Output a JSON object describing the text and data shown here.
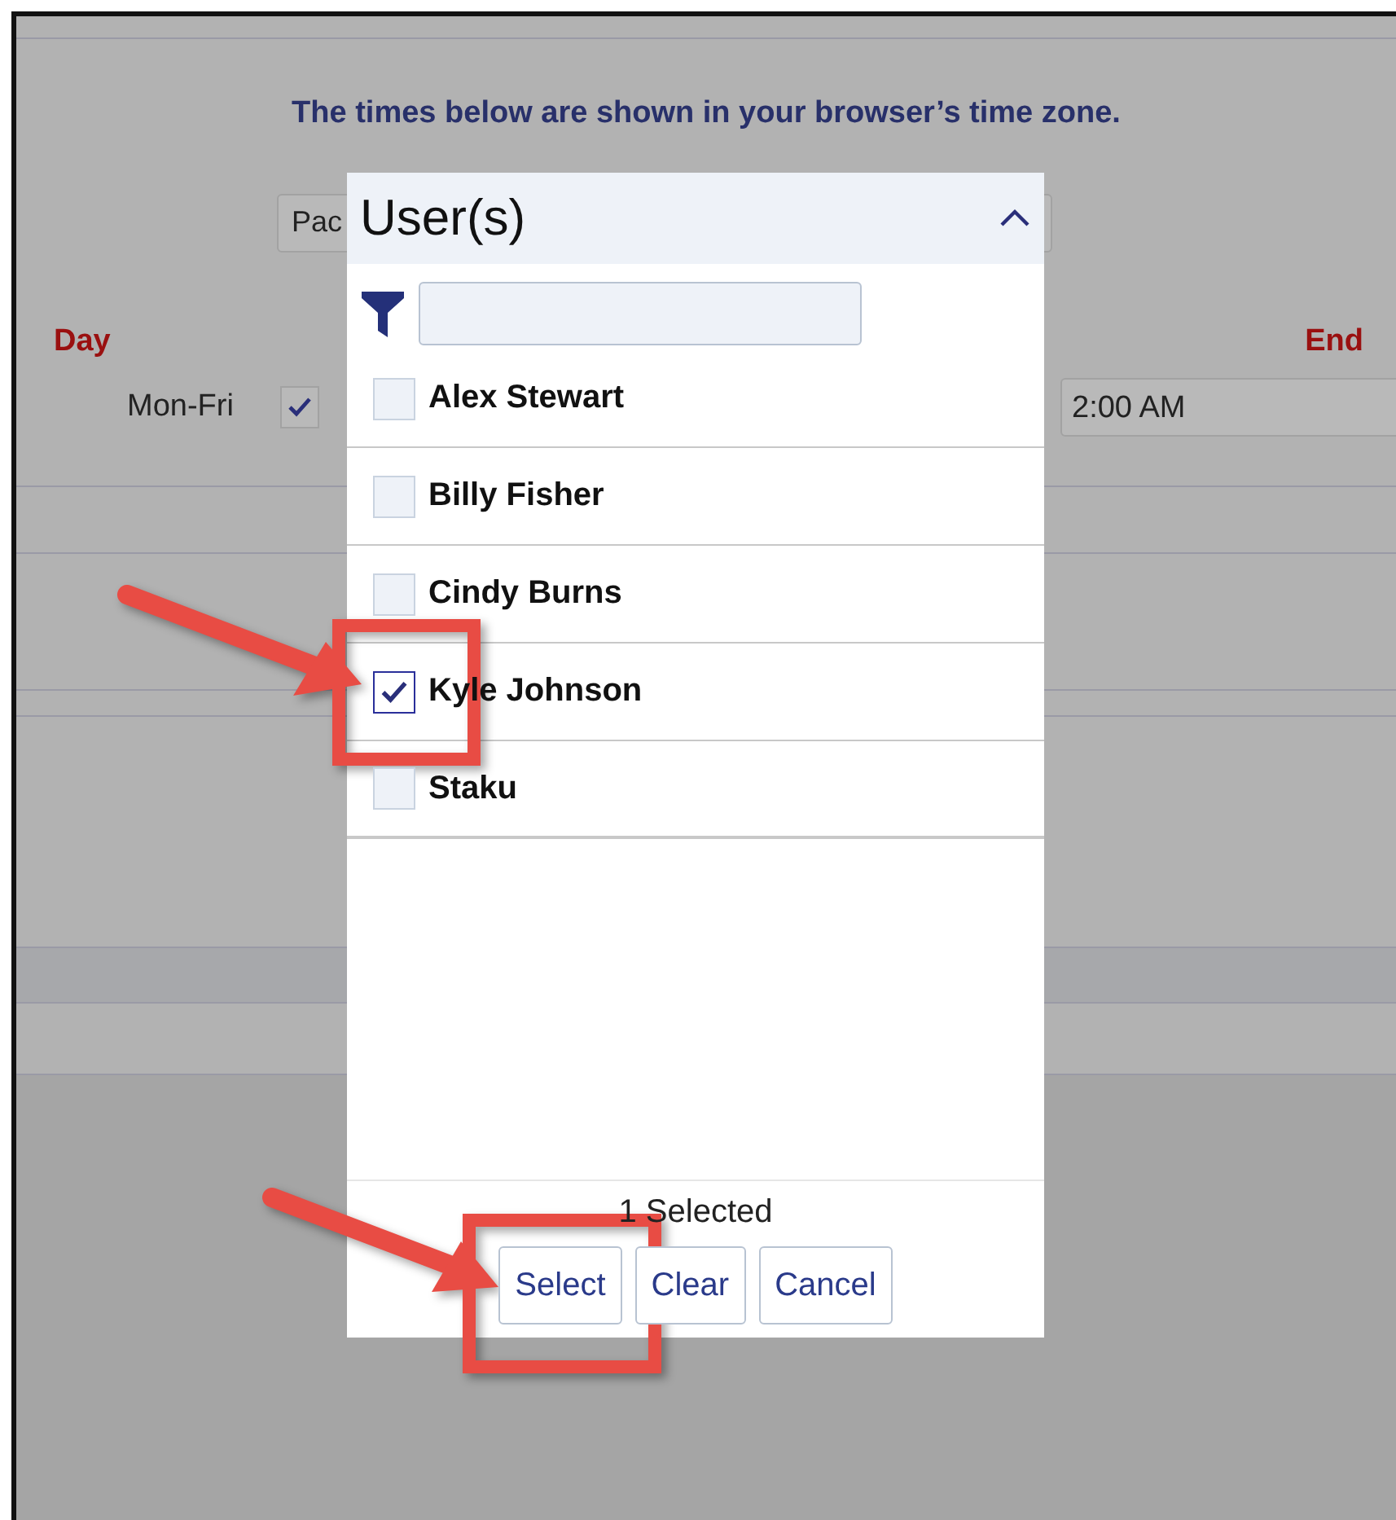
{
  "notice": "The times below are shown in your browser’s time zone.",
  "timezone_field": {
    "value": "Pac"
  },
  "schedule": {
    "day_header": "Day",
    "end_header": "End",
    "rows": [
      {
        "day": "Mon-Fri",
        "checked": true,
        "end_time": "2:00 AM"
      }
    ]
  },
  "dialog": {
    "title": "User(s)",
    "expanded": true,
    "users": [
      {
        "name": "Alex Stewart",
        "checked": false
      },
      {
        "name": "Billy Fisher",
        "checked": false
      },
      {
        "name": "Cindy Burns",
        "checked": false
      },
      {
        "name": "Kyle Johnson",
        "checked": true
      },
      {
        "name": "Staku",
        "checked": false
      }
    ],
    "selected_count": "1 Selected",
    "buttons": [
      "Select",
      "Clear",
      "Cancel"
    ]
  }
}
